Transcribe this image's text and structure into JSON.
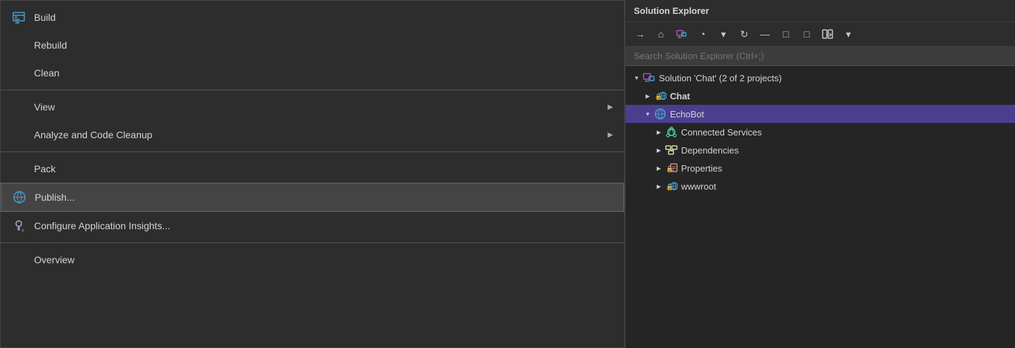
{
  "contextMenu": {
    "items": [
      {
        "id": "build",
        "label": "Build",
        "hasIcon": true,
        "iconName": "build-icon",
        "hasArrow": false,
        "isHighlighted": false
      },
      {
        "id": "rebuild",
        "label": "Rebuild",
        "hasIcon": false,
        "iconName": null,
        "hasArrow": false,
        "isHighlighted": false
      },
      {
        "id": "clean",
        "label": "Clean",
        "hasIcon": false,
        "iconName": null,
        "hasArrow": false,
        "isHighlighted": false
      },
      {
        "id": "view",
        "label": "View",
        "hasIcon": false,
        "iconName": null,
        "hasArrow": true,
        "isHighlighted": false
      },
      {
        "id": "analyze",
        "label": "Analyze and Code Cleanup",
        "hasIcon": false,
        "iconName": null,
        "hasArrow": true,
        "isHighlighted": false
      },
      {
        "id": "pack",
        "label": "Pack",
        "hasIcon": false,
        "iconName": null,
        "hasArrow": false,
        "isHighlighted": false
      },
      {
        "id": "publish",
        "label": "Publish...",
        "hasIcon": true,
        "iconName": "publish-icon",
        "hasArrow": false,
        "isHighlighted": true
      },
      {
        "id": "configure-insights",
        "label": "Configure Application Insights...",
        "hasIcon": true,
        "iconName": "configure-icon",
        "hasArrow": false,
        "isHighlighted": false
      },
      {
        "id": "overview",
        "label": "Overview",
        "hasIcon": false,
        "iconName": null,
        "hasArrow": false,
        "isHighlighted": false
      }
    ],
    "separators": [
      2,
      5,
      7
    ]
  },
  "solutionExplorer": {
    "title": "Solution Explorer",
    "searchPlaceholder": "Search Solution Explorer (Ctrl+;)",
    "toolbar": {
      "buttons": [
        "back-arrow",
        "home-icon",
        "visual-studio-icon",
        "history-icon",
        "dropdown-icon",
        "refresh-icon",
        "collapse-icon",
        "pane-icon",
        "split-icon",
        "dropdown2-icon"
      ]
    },
    "tree": [
      {
        "id": "solution",
        "level": 0,
        "label": "Solution 'Chat' (2 of 2 projects)",
        "iconType": "solution",
        "expanded": true,
        "bold": false
      },
      {
        "id": "chat",
        "level": 1,
        "label": "Chat",
        "iconType": "globe-lock",
        "expanded": false,
        "bold": true
      },
      {
        "id": "echobot",
        "level": 1,
        "label": "EchoBot",
        "iconType": "globe",
        "expanded": true,
        "bold": false,
        "selected": true
      },
      {
        "id": "connected-services",
        "level": 2,
        "label": "Connected Services",
        "iconType": "connected",
        "expanded": false,
        "bold": false
      },
      {
        "id": "dependencies",
        "level": 2,
        "label": "Dependencies",
        "iconType": "dependencies",
        "expanded": false,
        "bold": false
      },
      {
        "id": "properties",
        "level": 2,
        "label": "Properties",
        "iconType": "properties-lock",
        "expanded": false,
        "bold": false
      },
      {
        "id": "wwwroot",
        "level": 2,
        "label": "wwwroot",
        "iconType": "wwwroot-lock",
        "expanded": false,
        "bold": false
      }
    ]
  }
}
